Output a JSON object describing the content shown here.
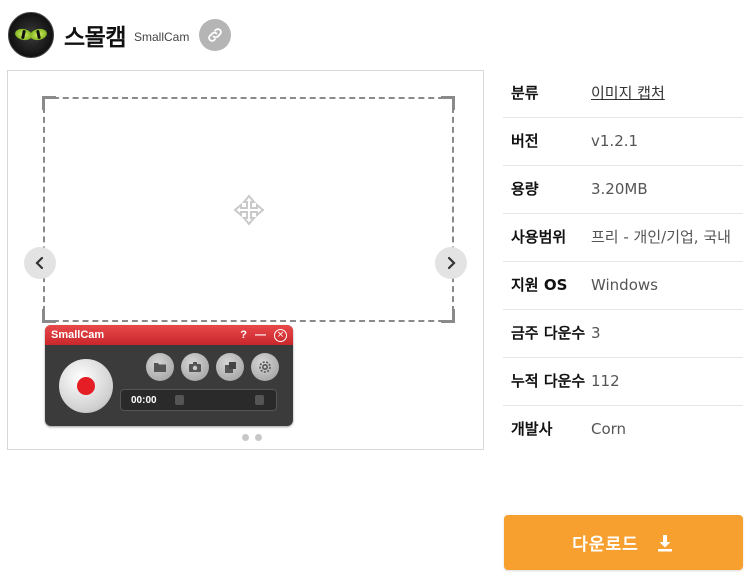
{
  "header": {
    "title": "스몰캠",
    "subtitle": "SmallCam",
    "icons": {
      "app": "cat-eye-icon",
      "link": "link-icon"
    }
  },
  "preview": {
    "widget": {
      "title": "SmallCam",
      "help": "?",
      "minimize": "—",
      "close": "×",
      "timer": "00:00"
    },
    "colors": {
      "accent_red": "#e51d25",
      "bar_red": "#c8282b"
    }
  },
  "info": {
    "rows": [
      {
        "label": "분류",
        "value": "이미지 캡처"
      },
      {
        "label": "버전",
        "value": "v1.2.1"
      },
      {
        "label": "용량",
        "value": "3.20MB"
      },
      {
        "label": "사용범위",
        "value": "프리 - 개인/기업, 국내"
      },
      {
        "label": "지원 OS",
        "value": "Windows"
      },
      {
        "label": "금주 다운수",
        "value": "3"
      },
      {
        "label": "누적 다운수",
        "value": "112"
      },
      {
        "label": "개발사",
        "value": "Corn"
      }
    ]
  },
  "download": {
    "label": "다운로드",
    "color": "#f7a030",
    "icon": "download-icon"
  }
}
